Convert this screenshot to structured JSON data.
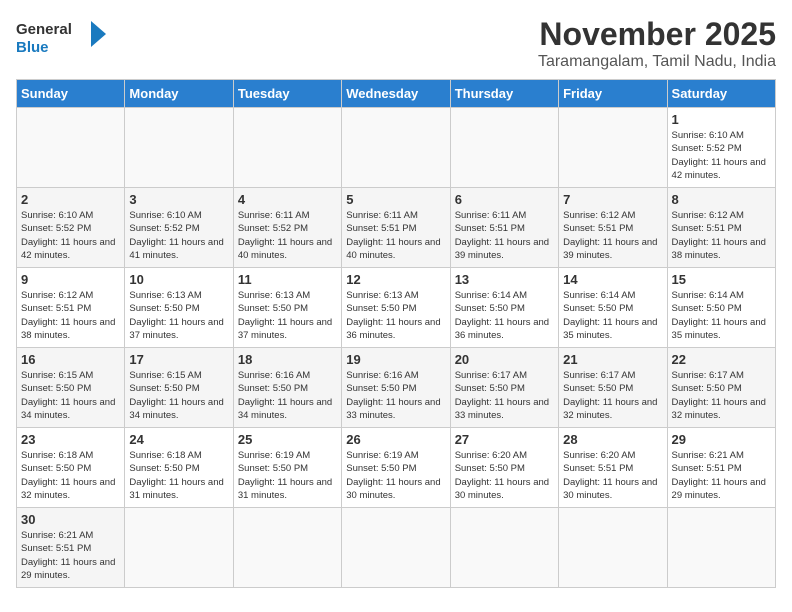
{
  "header": {
    "logo_general": "General",
    "logo_blue": "Blue",
    "month_title": "November 2025",
    "location": "Taramangalam, Tamil Nadu, India"
  },
  "days_of_week": [
    "Sunday",
    "Monday",
    "Tuesday",
    "Wednesday",
    "Thursday",
    "Friday",
    "Saturday"
  ],
  "weeks": [
    {
      "days": [
        {
          "num": "",
          "empty": true
        },
        {
          "num": "",
          "empty": true
        },
        {
          "num": "",
          "empty": true
        },
        {
          "num": "",
          "empty": true
        },
        {
          "num": "",
          "empty": true
        },
        {
          "num": "",
          "empty": true
        },
        {
          "num": "1",
          "sunrise": "Sunrise: 6:10 AM",
          "sunset": "Sunset: 5:52 PM",
          "daylight": "Daylight: 11 hours and 42 minutes."
        }
      ]
    },
    {
      "days": [
        {
          "num": "2",
          "sunrise": "Sunrise: 6:10 AM",
          "sunset": "Sunset: 5:52 PM",
          "daylight": "Daylight: 11 hours and 42 minutes."
        },
        {
          "num": "3",
          "sunrise": "Sunrise: 6:10 AM",
          "sunset": "Sunset: 5:52 PM",
          "daylight": "Daylight: 11 hours and 41 minutes."
        },
        {
          "num": "4",
          "sunrise": "Sunrise: 6:11 AM",
          "sunset": "Sunset: 5:52 PM",
          "daylight": "Daylight: 11 hours and 40 minutes."
        },
        {
          "num": "5",
          "sunrise": "Sunrise: 6:11 AM",
          "sunset": "Sunset: 5:51 PM",
          "daylight": "Daylight: 11 hours and 40 minutes."
        },
        {
          "num": "6",
          "sunrise": "Sunrise: 6:11 AM",
          "sunset": "Sunset: 5:51 PM",
          "daylight": "Daylight: 11 hours and 39 minutes."
        },
        {
          "num": "7",
          "sunrise": "Sunrise: 6:12 AM",
          "sunset": "Sunset: 5:51 PM",
          "daylight": "Daylight: 11 hours and 39 minutes."
        },
        {
          "num": "8",
          "sunrise": "Sunrise: 6:12 AM",
          "sunset": "Sunset: 5:51 PM",
          "daylight": "Daylight: 11 hours and 38 minutes."
        }
      ]
    },
    {
      "days": [
        {
          "num": "9",
          "sunrise": "Sunrise: 6:12 AM",
          "sunset": "Sunset: 5:51 PM",
          "daylight": "Daylight: 11 hours and 38 minutes."
        },
        {
          "num": "10",
          "sunrise": "Sunrise: 6:13 AM",
          "sunset": "Sunset: 5:50 PM",
          "daylight": "Daylight: 11 hours and 37 minutes."
        },
        {
          "num": "11",
          "sunrise": "Sunrise: 6:13 AM",
          "sunset": "Sunset: 5:50 PM",
          "daylight": "Daylight: 11 hours and 37 minutes."
        },
        {
          "num": "12",
          "sunrise": "Sunrise: 6:13 AM",
          "sunset": "Sunset: 5:50 PM",
          "daylight": "Daylight: 11 hours and 36 minutes."
        },
        {
          "num": "13",
          "sunrise": "Sunrise: 6:14 AM",
          "sunset": "Sunset: 5:50 PM",
          "daylight": "Daylight: 11 hours and 36 minutes."
        },
        {
          "num": "14",
          "sunrise": "Sunrise: 6:14 AM",
          "sunset": "Sunset: 5:50 PM",
          "daylight": "Daylight: 11 hours and 35 minutes."
        },
        {
          "num": "15",
          "sunrise": "Sunrise: 6:14 AM",
          "sunset": "Sunset: 5:50 PM",
          "daylight": "Daylight: 11 hours and 35 minutes."
        }
      ]
    },
    {
      "days": [
        {
          "num": "16",
          "sunrise": "Sunrise: 6:15 AM",
          "sunset": "Sunset: 5:50 PM",
          "daylight": "Daylight: 11 hours and 34 minutes."
        },
        {
          "num": "17",
          "sunrise": "Sunrise: 6:15 AM",
          "sunset": "Sunset: 5:50 PM",
          "daylight": "Daylight: 11 hours and 34 minutes."
        },
        {
          "num": "18",
          "sunrise": "Sunrise: 6:16 AM",
          "sunset": "Sunset: 5:50 PM",
          "daylight": "Daylight: 11 hours and 34 minutes."
        },
        {
          "num": "19",
          "sunrise": "Sunrise: 6:16 AM",
          "sunset": "Sunset: 5:50 PM",
          "daylight": "Daylight: 11 hours and 33 minutes."
        },
        {
          "num": "20",
          "sunrise": "Sunrise: 6:17 AM",
          "sunset": "Sunset: 5:50 PM",
          "daylight": "Daylight: 11 hours and 33 minutes."
        },
        {
          "num": "21",
          "sunrise": "Sunrise: 6:17 AM",
          "sunset": "Sunset: 5:50 PM",
          "daylight": "Daylight: 11 hours and 32 minutes."
        },
        {
          "num": "22",
          "sunrise": "Sunrise: 6:17 AM",
          "sunset": "Sunset: 5:50 PM",
          "daylight": "Daylight: 11 hours and 32 minutes."
        }
      ]
    },
    {
      "days": [
        {
          "num": "23",
          "sunrise": "Sunrise: 6:18 AM",
          "sunset": "Sunset: 5:50 PM",
          "daylight": "Daylight: 11 hours and 32 minutes."
        },
        {
          "num": "24",
          "sunrise": "Sunrise: 6:18 AM",
          "sunset": "Sunset: 5:50 PM",
          "daylight": "Daylight: 11 hours and 31 minutes."
        },
        {
          "num": "25",
          "sunrise": "Sunrise: 6:19 AM",
          "sunset": "Sunset: 5:50 PM",
          "daylight": "Daylight: 11 hours and 31 minutes."
        },
        {
          "num": "26",
          "sunrise": "Sunrise: 6:19 AM",
          "sunset": "Sunset: 5:50 PM",
          "daylight": "Daylight: 11 hours and 30 minutes."
        },
        {
          "num": "27",
          "sunrise": "Sunrise: 6:20 AM",
          "sunset": "Sunset: 5:50 PM",
          "daylight": "Daylight: 11 hours and 30 minutes."
        },
        {
          "num": "28",
          "sunrise": "Sunrise: 6:20 AM",
          "sunset": "Sunset: 5:51 PM",
          "daylight": "Daylight: 11 hours and 30 minutes."
        },
        {
          "num": "29",
          "sunrise": "Sunrise: 6:21 AM",
          "sunset": "Sunset: 5:51 PM",
          "daylight": "Daylight: 11 hours and 29 minutes."
        }
      ]
    },
    {
      "days": [
        {
          "num": "30",
          "sunrise": "Sunrise: 6:21 AM",
          "sunset": "Sunset: 5:51 PM",
          "daylight": "Daylight: 11 hours and 29 minutes."
        },
        {
          "num": "",
          "empty": true
        },
        {
          "num": "",
          "empty": true
        },
        {
          "num": "",
          "empty": true
        },
        {
          "num": "",
          "empty": true
        },
        {
          "num": "",
          "empty": true
        },
        {
          "num": "",
          "empty": true
        }
      ]
    }
  ]
}
